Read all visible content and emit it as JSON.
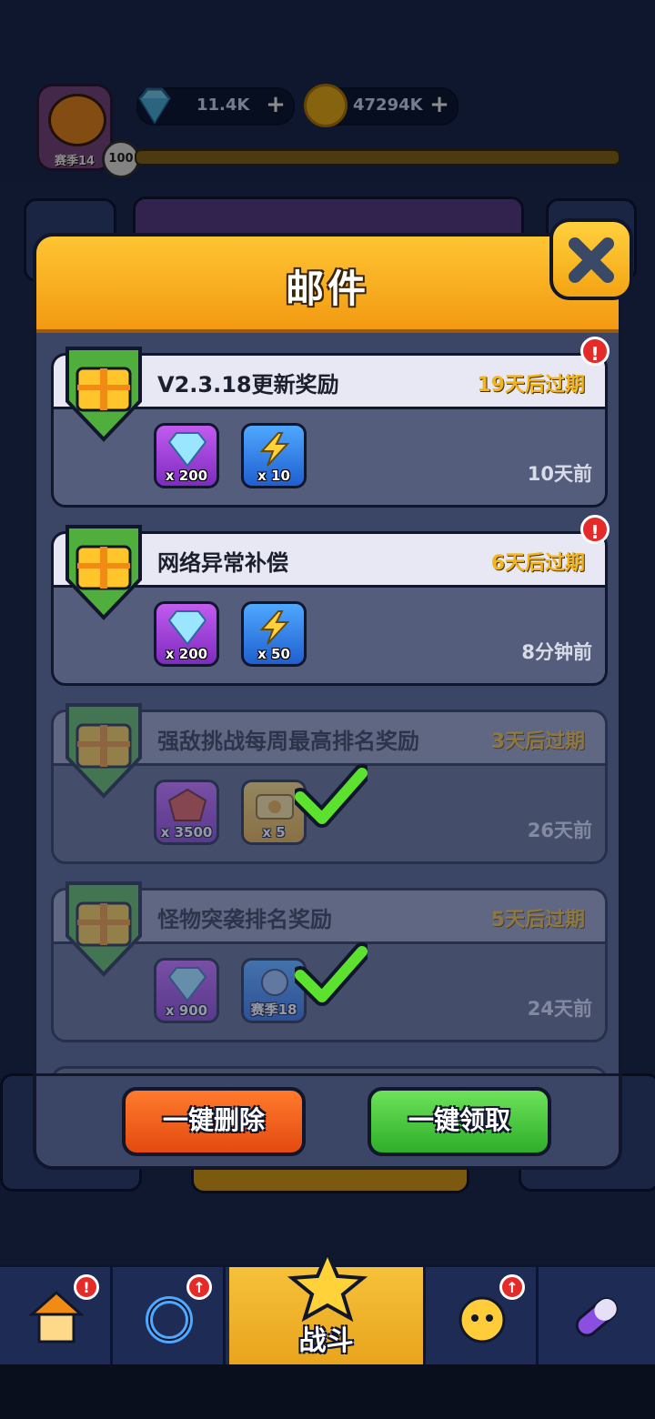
{
  "header": {
    "season_label": "赛季14",
    "level": "100",
    "gems": "11.4K",
    "coins": "47294K",
    "plus": "+"
  },
  "modal": {
    "title": "邮件",
    "mails": [
      {
        "title": "V2.3.18更新奖励",
        "expiry": "19天后过期",
        "age": "10天前",
        "claimed": false,
        "alert": "!",
        "rewards": [
          {
            "icon": "diamond-icon",
            "qty": "x 200"
          },
          {
            "icon": "lightning-icon",
            "qty": "x 10"
          }
        ]
      },
      {
        "title": "网络异常补偿",
        "expiry": "6天后过期",
        "age": "8分钟前",
        "claimed": false,
        "alert": "!",
        "rewards": [
          {
            "icon": "diamond-icon",
            "qty": "x 200"
          },
          {
            "icon": "lightning-icon",
            "qty": "x 50"
          }
        ]
      },
      {
        "title": "强敌挑战每周最高排名奖励",
        "expiry": "3天后过期",
        "age": "26天前",
        "claimed": true,
        "rewards": [
          {
            "icon": "red-gem-icon",
            "qty": "x 3500"
          },
          {
            "icon": "ticket-icon",
            "qty": "x 5"
          }
        ]
      },
      {
        "title": "怪物突袭排名奖励",
        "expiry": "5天后过期",
        "age": "24天前",
        "claimed": true,
        "rewards": [
          {
            "icon": "diamond-icon",
            "qty": "x 900"
          },
          {
            "icon": "season-avatar-icon",
            "qty": "赛季18"
          }
        ]
      }
    ],
    "delete_all_label": "一键删除",
    "claim_all_label": "一键领取"
  },
  "bottom_nav": {
    "battle_label": "战斗",
    "alert": "!"
  },
  "colors": {
    "accent": "#f6b41f",
    "expiry": "#f2b51c",
    "delete": "#ee5a16",
    "claim": "#3cc23a"
  }
}
